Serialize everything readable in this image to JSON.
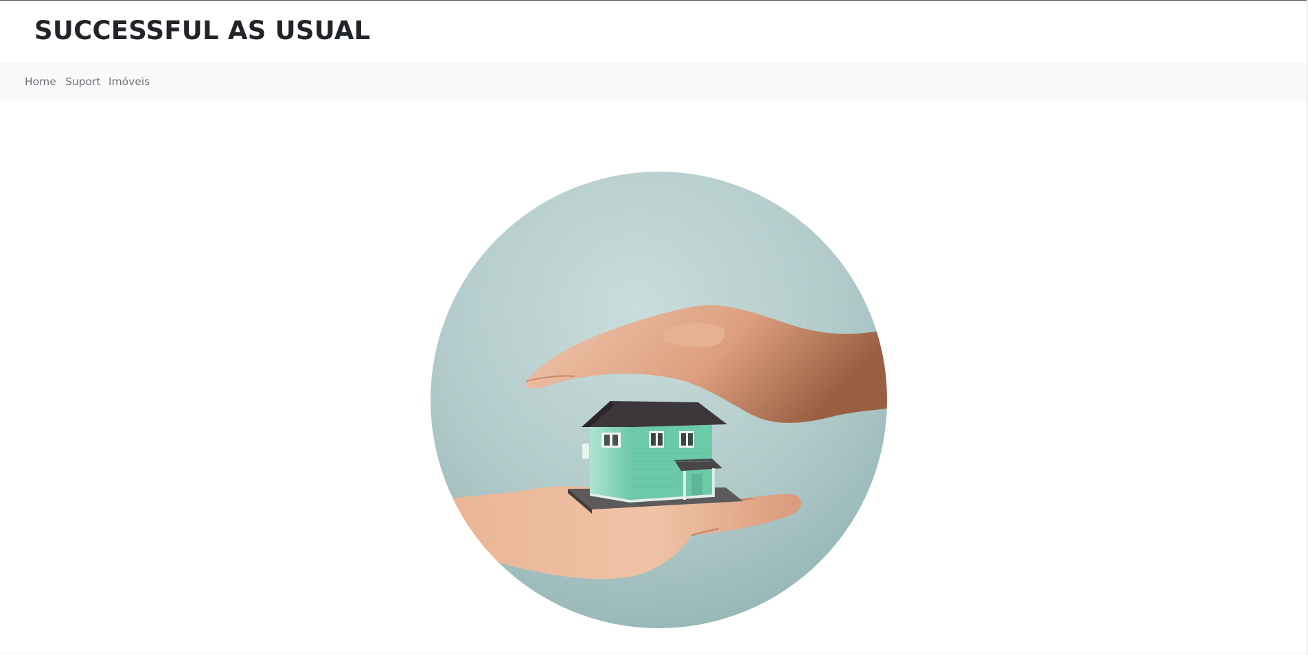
{
  "header": {
    "title": "SUCCESSFUL AS USUAL"
  },
  "nav": {
    "items": [
      "Home",
      "Suport",
      "Imóveis"
    ]
  },
  "hero": {
    "image": "house-in-hands-icon",
    "colors": {
      "background": "#b4cdcb",
      "house_wall": "#7fd3b8",
      "roof": "#3f3a40",
      "skin": "#e3a581"
    }
  }
}
